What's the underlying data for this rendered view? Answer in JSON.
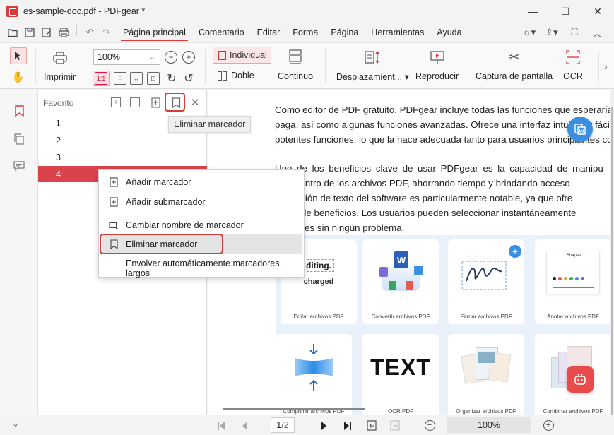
{
  "window": {
    "title": "es-sample-doc.pdf - PDFgear *",
    "minimize": "—",
    "maximize": "☐",
    "close": "✕"
  },
  "menu": {
    "items": [
      "Página principal",
      "Comentario",
      "Editar",
      "Forma",
      "Página",
      "Herramientas",
      "Ayuda"
    ],
    "active": "Página principal"
  },
  "ribbon": {
    "print": "Imprimir",
    "zoom_value": "100%",
    "individual": "Individual",
    "doble": "Doble",
    "continuo": "Continuo",
    "desplazamiento": "Desplazamient...",
    "reproducir": "Reproducir",
    "captura": "Captura de pantalla",
    "ocr": "OCR"
  },
  "panel": {
    "title": "Favorito",
    "bookmarks": [
      "1",
      "2",
      "3",
      "4"
    ],
    "selected": "4"
  },
  "tooltip": "Eliminar marcador",
  "context_menu": {
    "items": [
      "Añadir marcador",
      "Añadir submarcador",
      "Cambiar nombre de marcador",
      "Eliminar marcador",
      "Envolver automáticamente marcadores largos"
    ],
    "highlighted": "Eliminar marcador"
  },
  "document": {
    "paragraph1": [
      "Como editor de PDF gratuito, PDFgear incluye todas las funciones que esperaría",
      "paga, así como algunas funciones avanzadas. Ofrece una interfaz intuitiva y fácil d",
      "potentes funciones, lo que la hace adecuada tanto para usuarios principiantes co"
    ],
    "paragraph2": [
      "Uno de los beneficios clave de usar PDFgear es la capacidad de manipu",
      "ción dentro de los archivos PDF, ahorrando tiempo y brindando acceso",
      "de edición de texto del software es particularmente notable, ya que ofre",
      "gama de beneficios. Los usuarios pueden seleccionar instantáneamente",
      "ediciones sin ningún problema."
    ],
    "cards": [
      "Editar archivos PDF",
      "Convertir archivos PDF",
      "Firmar archivos PDF",
      "Anotar archivos PDF",
      "Comprimir archivos PDF",
      "OCR PDF",
      "Organizar archivos PDF",
      "Combinar archivos PDF"
    ],
    "card1_art": [
      "diting.",
      "charged"
    ],
    "card2_art": "W",
    "card6_art": "TEXT",
    "card4_art": "Shapes"
  },
  "status": {
    "page_current": "1",
    "page_total": "/2",
    "zoom": "100%"
  },
  "colors": {
    "accent": "#d93c3c",
    "selected_row": "#d9434b",
    "float_blue": "#3a8fe0"
  }
}
